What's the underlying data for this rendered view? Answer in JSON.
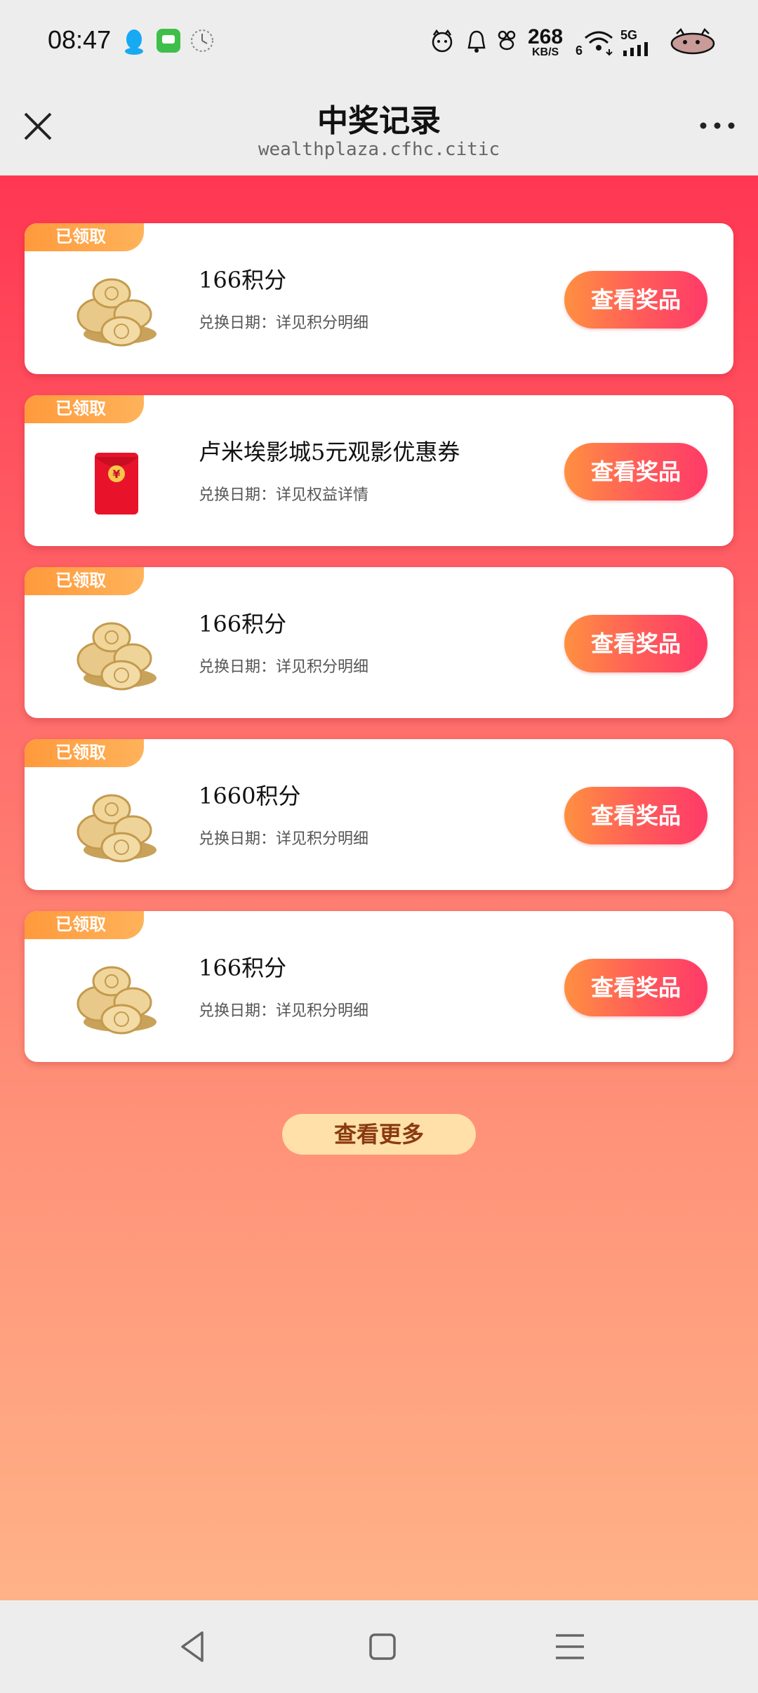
{
  "status_bar": {
    "time": "08:47",
    "net_speed_value": "268",
    "net_speed_unit": "KB/S",
    "signal_label": "5G",
    "sim_index": "6",
    "icons": [
      "qq-icon",
      "message-app-icon",
      "clock-app-icon",
      "cat-face-icon",
      "alarm-icon",
      "paw-icon",
      "wifi-icon",
      "signal-icon",
      "battery-icon"
    ]
  },
  "header": {
    "title": "中奖记录",
    "subtitle": "wealthplaza.cfhc.citic"
  },
  "records": [
    {
      "badge": "已领取",
      "title": "166积分",
      "date": "兑换日期：详见积分明细",
      "button": "查看奖品",
      "thumb": "coins"
    },
    {
      "badge": "已领取",
      "title": "卢米埃影城5元观影优惠券",
      "date": "兑换日期：详见权益详情",
      "button": "查看奖品",
      "thumb": "red-packet"
    },
    {
      "badge": "已领取",
      "title": "166积分",
      "date": "兑换日期：详见积分明细",
      "button": "查看奖品",
      "thumb": "coins"
    },
    {
      "badge": "已领取",
      "title": "1660积分",
      "date": "兑换日期：详见积分明细",
      "button": "查看奖品",
      "thumb": "coins"
    },
    {
      "badge": "已领取",
      "title": "166积分",
      "date": "兑换日期：详见积分明细",
      "button": "查看奖品",
      "thumb": "coins"
    }
  ],
  "more_button": "查看更多",
  "colors": {
    "gradient_top": "#ff3652",
    "gradient_bottom": "#ffb287",
    "badge": "#ff9a3c",
    "button_start": "#ff9040",
    "button_end": "#ff3a68",
    "more_button_bg": "#ffe0a8"
  },
  "nav_icons": [
    "back-triangle-icon",
    "home-square-icon",
    "menu-lines-icon"
  ]
}
